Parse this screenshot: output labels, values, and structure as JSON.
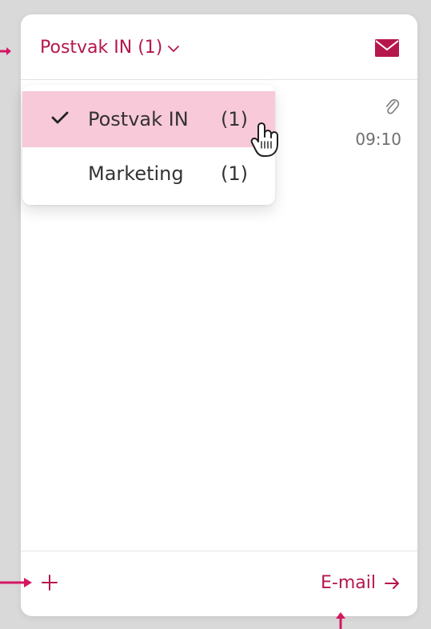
{
  "header": {
    "folder_toggle_label": "Postvak IN (1)",
    "toggle_icon": "chevron-down-icon",
    "mail_icon": "mail-icon"
  },
  "list": {
    "attachment_icon": "paperclip-icon",
    "time": "09:10"
  },
  "dropdown": {
    "items": [
      {
        "label": "Postvak IN",
        "count": "(1)",
        "selected": true
      },
      {
        "label": "Marketing",
        "count": "(1)",
        "selected": false
      }
    ]
  },
  "footer": {
    "add_icon": "plus-icon",
    "email_label": "E-mail",
    "arrow_icon": "arrow-right-icon"
  },
  "colors": {
    "accent": "#b5174d",
    "selection": "#f8c9d8",
    "annotation": "#d51762",
    "text": "#333333",
    "muted": "#6f6f6f"
  }
}
